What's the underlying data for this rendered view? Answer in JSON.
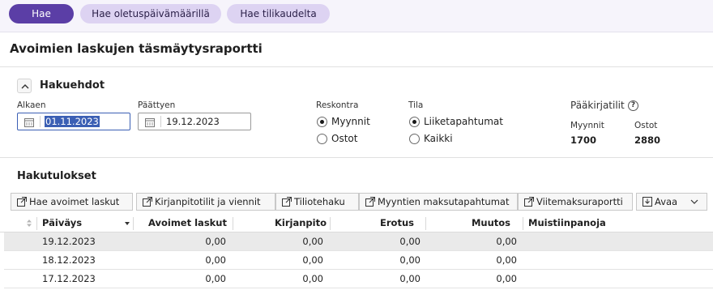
{
  "topbar": {
    "primary_button": "Hae",
    "default_dates_button": "Hae oletuspäivämäärillä",
    "fiscal_year_button": "Hae tilikaudelta"
  },
  "page_title": "Avoimien laskujen täsmäytysraportti",
  "filters": {
    "section_title": "Hakuehdot",
    "start_label": "Alkaen",
    "start_value": "01.11.2023",
    "end_label": "Päättyen",
    "end_value": "19.12.2023",
    "ledger_label": "Reskontra",
    "ledger_options": [
      "Myynnit",
      "Ostot"
    ],
    "ledger_selected": "Myynnit",
    "status_label": "Tila",
    "status_options": [
      "Liiketapahtumat",
      "Kaikki"
    ],
    "status_selected": "Liiketapahtumat",
    "gl_accounts_label": "Pääkirjatilit",
    "gl_accounts": [
      {
        "label": "Myynnit",
        "value": "1700"
      },
      {
        "label": "Ostot",
        "value": "2880"
      }
    ]
  },
  "results": {
    "section_title": "Hakutulokset",
    "toolbar": [
      {
        "label": "Hae avoimet laskut",
        "icon": "open-external-icon"
      },
      {
        "label": "Kirjanpitotilit ja viennit",
        "icon": "open-external-icon"
      },
      {
        "label": "Tiliotehaku",
        "icon": "open-external-icon"
      },
      {
        "label": "Myyntien maksutapahtumat",
        "icon": "open-external-icon"
      },
      {
        "label": "Viitemaksuraportti",
        "icon": "open-external-icon"
      },
      {
        "label": "Avaa",
        "icon": "download-icon"
      }
    ],
    "columns": [
      "Päiväys",
      "Avoimet laskut",
      "Kirjanpito",
      "Erotus",
      "Muutos",
      "Muistiinpanoja"
    ],
    "rows": [
      [
        "19.12.2023",
        "0,00",
        "0,00",
        "0,00",
        "0,00",
        ""
      ],
      [
        "18.12.2023",
        "0,00",
        "0,00",
        "0,00",
        "0,00",
        ""
      ],
      [
        "17.12.2023",
        "0,00",
        "0,00",
        "0,00",
        "0,00",
        ""
      ]
    ]
  },
  "colors": {
    "primary": "#5b3ea6",
    "secondary_pill": "#ddd3f2",
    "focus": "#3b5fb4"
  }
}
